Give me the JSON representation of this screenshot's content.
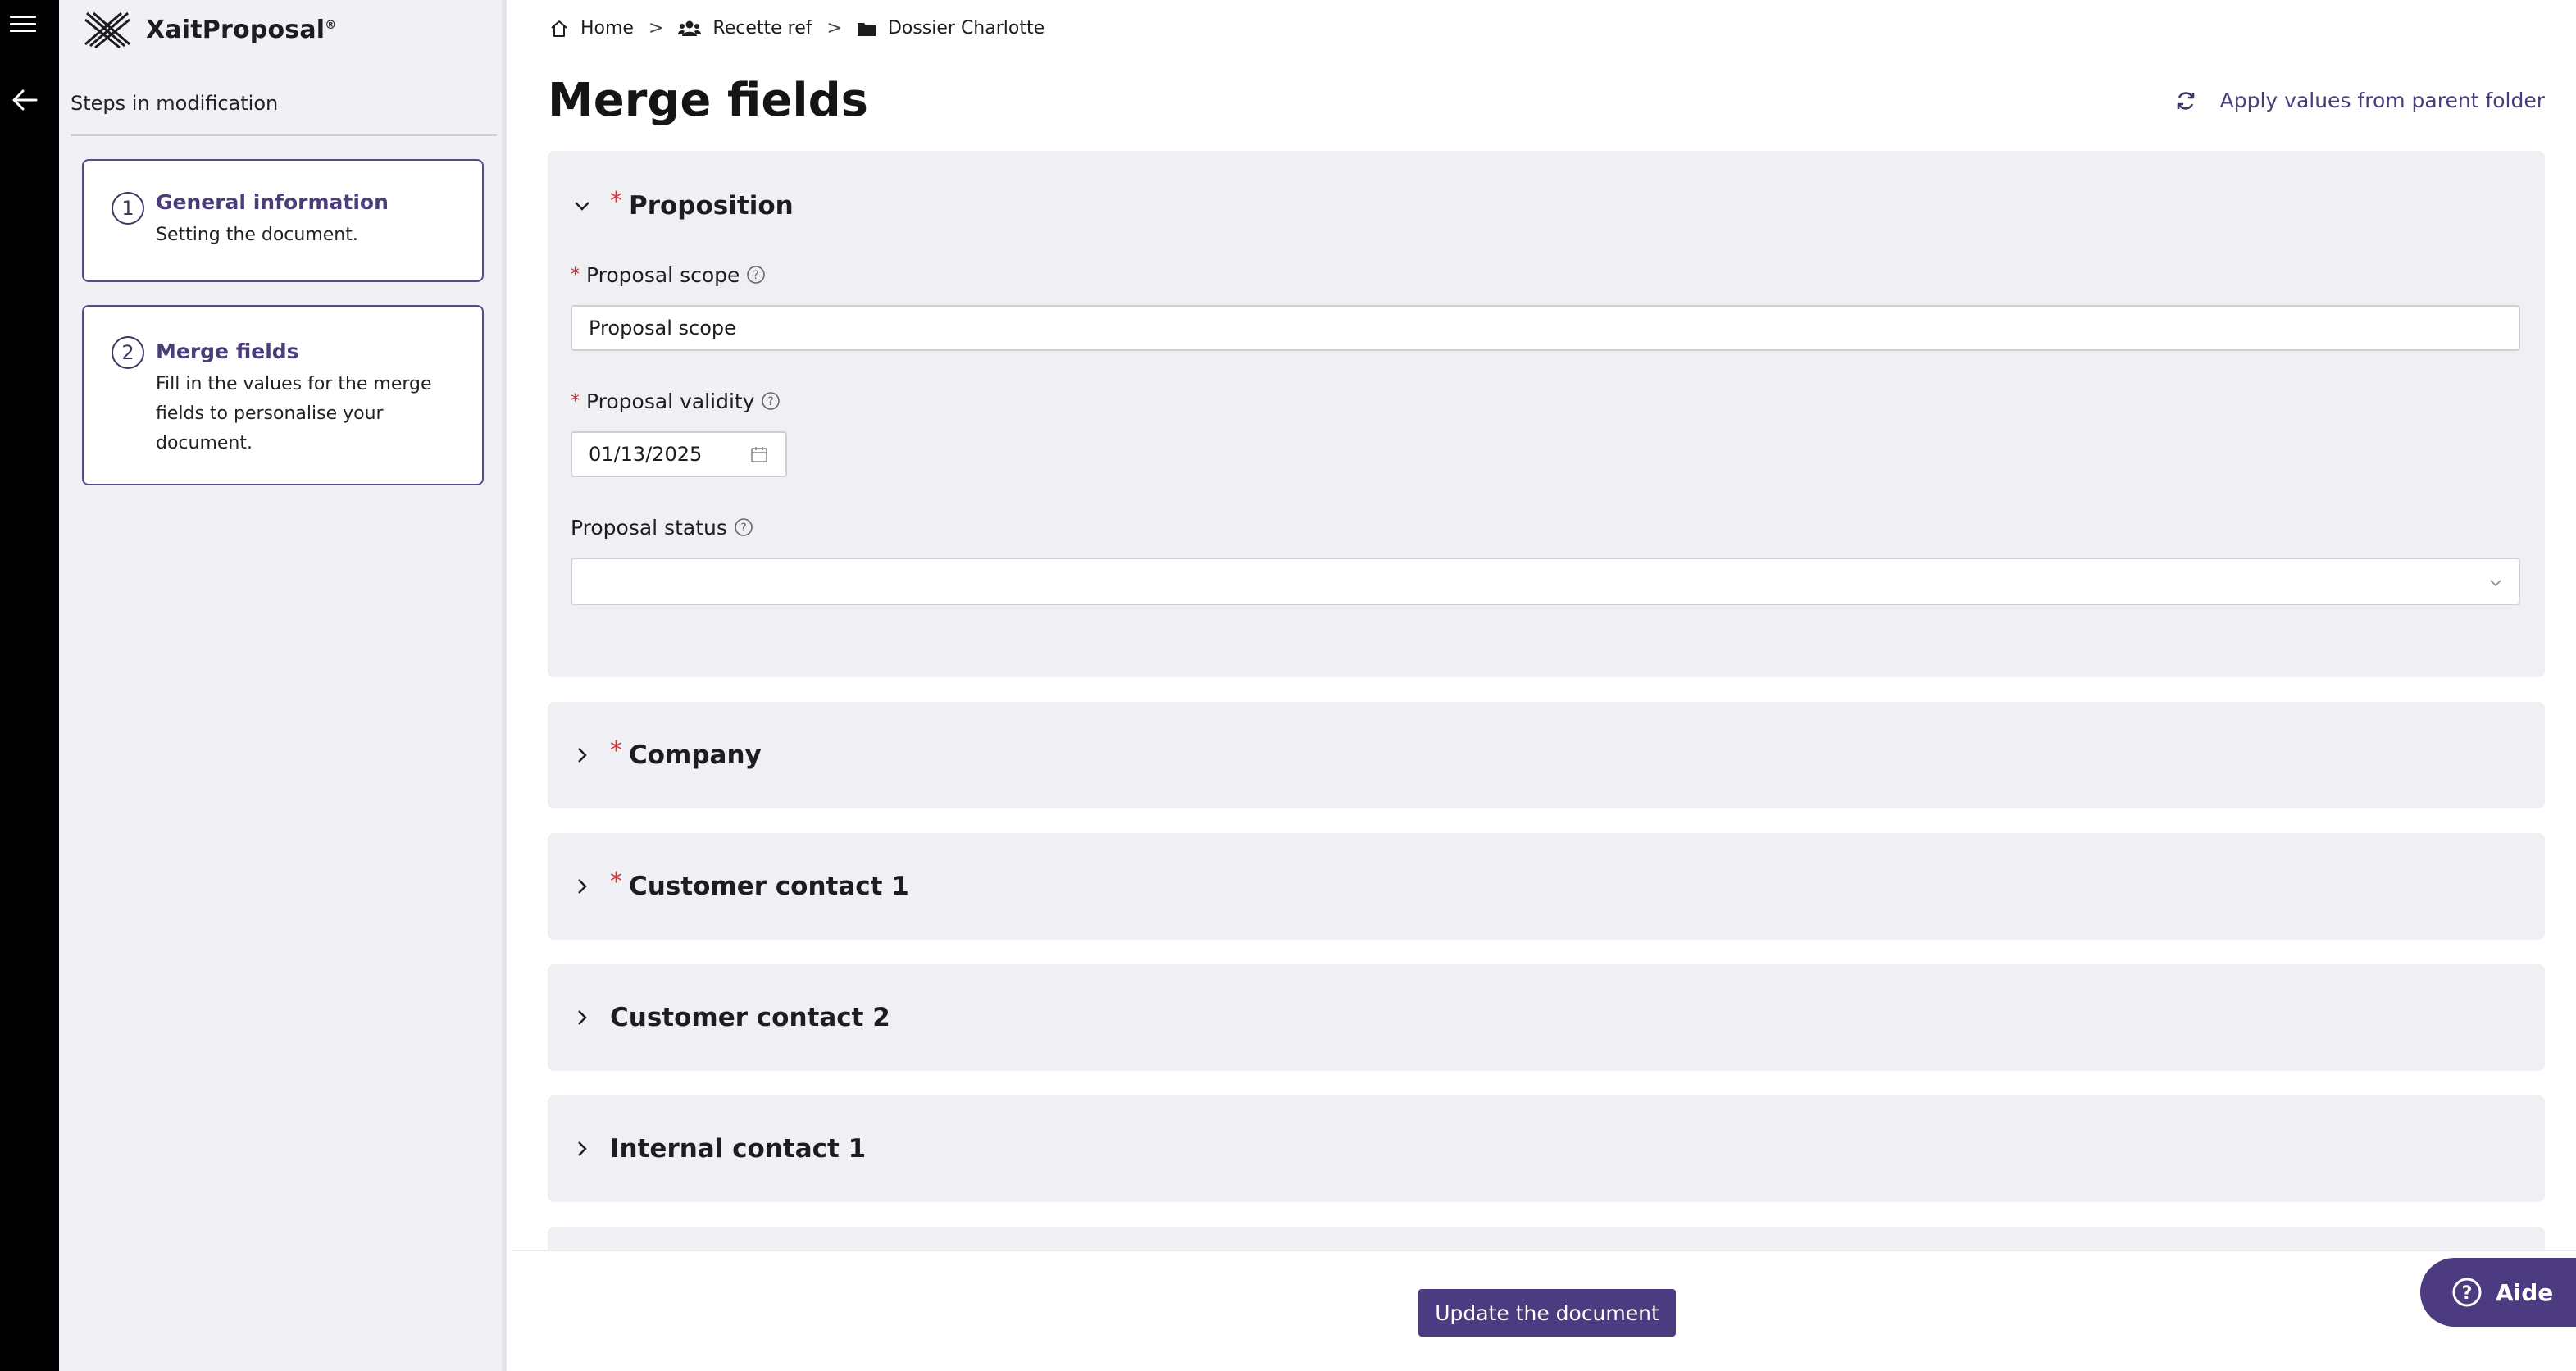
{
  "app": {
    "name": "XaitProposal",
    "trademark": "®"
  },
  "sidebar": {
    "heading": "Steps in modification",
    "steps": [
      {
        "number": "1",
        "title": "General information",
        "description": "Setting the document."
      },
      {
        "number": "2",
        "title": "Merge fields",
        "description": "Fill in the values for the merge fields to personalise your document."
      }
    ]
  },
  "breadcrumb": [
    {
      "label": "Home",
      "icon": "home-icon"
    },
    {
      "label": "Recette ref",
      "icon": "users-icon"
    },
    {
      "label": "Dossier Charlotte",
      "icon": "folder-icon"
    }
  ],
  "breadcrumb_separator": ">",
  "page": {
    "title": "Merge fields",
    "apply_label": "Apply values from parent folder"
  },
  "sections": {
    "proposition": {
      "title": "Proposition",
      "required": "*",
      "fields": {
        "scope": {
          "label": "Proposal scope",
          "required": "*",
          "value": "Proposal scope"
        },
        "validity": {
          "label": "Proposal validity",
          "required": "*",
          "value": "01/13/2025"
        },
        "status": {
          "label": "Proposal status",
          "value": ""
        }
      }
    },
    "company": {
      "title": "Company",
      "required": "*"
    },
    "customer_contact_1": {
      "title": "Customer contact 1",
      "required": "*"
    },
    "customer_contact_2": {
      "title": "Customer contact 2"
    },
    "internal_contact_1": {
      "title": "Internal contact 1"
    }
  },
  "footer": {
    "update_label": "Update the document"
  },
  "help_button": {
    "label": "Aide"
  },
  "colors": {
    "accent": "#4d3b82",
    "required": "#d8312f",
    "section_bg": "#f0f0f4",
    "rail": "#000000"
  }
}
